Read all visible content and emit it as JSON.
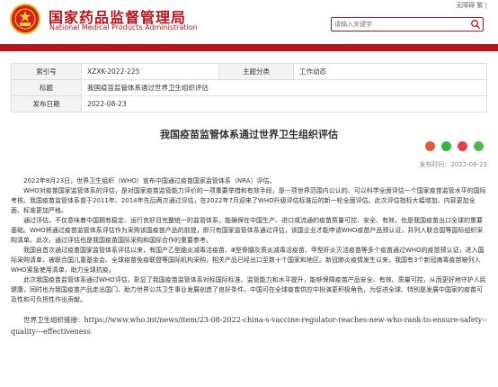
{
  "header": {
    "title_cn": "国家药品监督管理局",
    "title_en": "National Medical Products Administration",
    "top_links": "无障碍  繁 |",
    "search_placeholder": "请输入关键字"
  },
  "info": {
    "index_label": "索引号",
    "index_value": "XZXK-2022-225",
    "category_label": "主题分类",
    "category_value": "工作动态",
    "title_label": "标题",
    "title_value": "我国疫苗监管体系通过世界卫生组织评估",
    "date_label": "发布日期",
    "date_value": "2022-08-23"
  },
  "article": {
    "title": "我国疫苗监管体系通过世界卫生组织评估",
    "date": "发布时间：2022-08-23",
    "paragraphs": [
      "2022年8月23日，世界卫生组织（WHO）宣布中国通过疫苗国家监管体系（NRA）评估。",
      "WHO对疫苗国家监管体系的评估，是对国家疫苗监管能力评价的一项重要举措和有效手段，是一项世界范围内公认的、可以科学全面评估一个国家疫苗监管水平的国际考核。我国疫苗监管体系曾于2011年、2014年先后两次通过评估，在2022年7月迎来了WHO升级评估标准后的新一轮全面评估。此次评估指标大幅增加、内容更加全面、标准更加严格。",
      "通过评估，不仅意味着中国拥有稳定、运行良好且完整统一的监管体系，能确保在中国生产、进口或流通的疫苗质量可控、安全、有效，也是我国疫苗出口全球的重要基础。WHO将通过疫苗监管体系评估作为采购该国疫苗产品的前提，即只有国家监管体系通过评估，该国企业才能申请WHO疫苗产品预认证，并列入联合国等国际组织采购清单。此次，通过评估也是我国疫苗国际采购和国际合作的重要参考。",
      "我国自首次通过疫苗国家监管体系评估以来，有国产乙型脑炎减毒活疫苗、Ⅲ型脊髓灰质炎减毒活疫苗、甲型肝炎灭活疫苗等多个疫苗通过WHO的疫苗预认证，进入国际采购清单，被联合国儿童基金会、全球疫苗免疫联盟等国际机构采购，相关产品已经出口至数十个国家和地区。新冠肺炎疫情发生以来，我国有3个新冠病毒疫苗被列入WHO紧急使用清单，助力全球抗疫。",
      "此次我国疫苗监管体系通过WHO评估，彰显了我国疫苗监管体系对标国际标准、监管能力和水平提升，能够保障疫苗产品安全、有效、质量可控，从而更好地守护人民健康，同时也为我国疫苗产品走出国门、助力世界公共卫生事业发展创造了良好条件。中国可在全球疫苗供应中扮演更积极角色，为促进全球、特别是发展中国家的疫苗可及性和可负担性作出贡献。"
    ],
    "link_label": "世界卫生组织链接：",
    "link_url": "https://www.who.int/news/item/23-08-2022-china-s-vaccine-regulator-reaches-new-who-rank-to-ensure-safety--quality---effectiveness"
  },
  "colors": {
    "brand_red": "#b8141c",
    "share_icons": [
      "#e35a3c",
      "#3ab04a",
      "#e0404a",
      "#52b848"
    ]
  },
  "icons": [
    "national-emblem-icon",
    "search-icon",
    "share-weibo-icon",
    "share-wechat-icon",
    "share-qzone-icon",
    "share-friends-icon"
  ]
}
